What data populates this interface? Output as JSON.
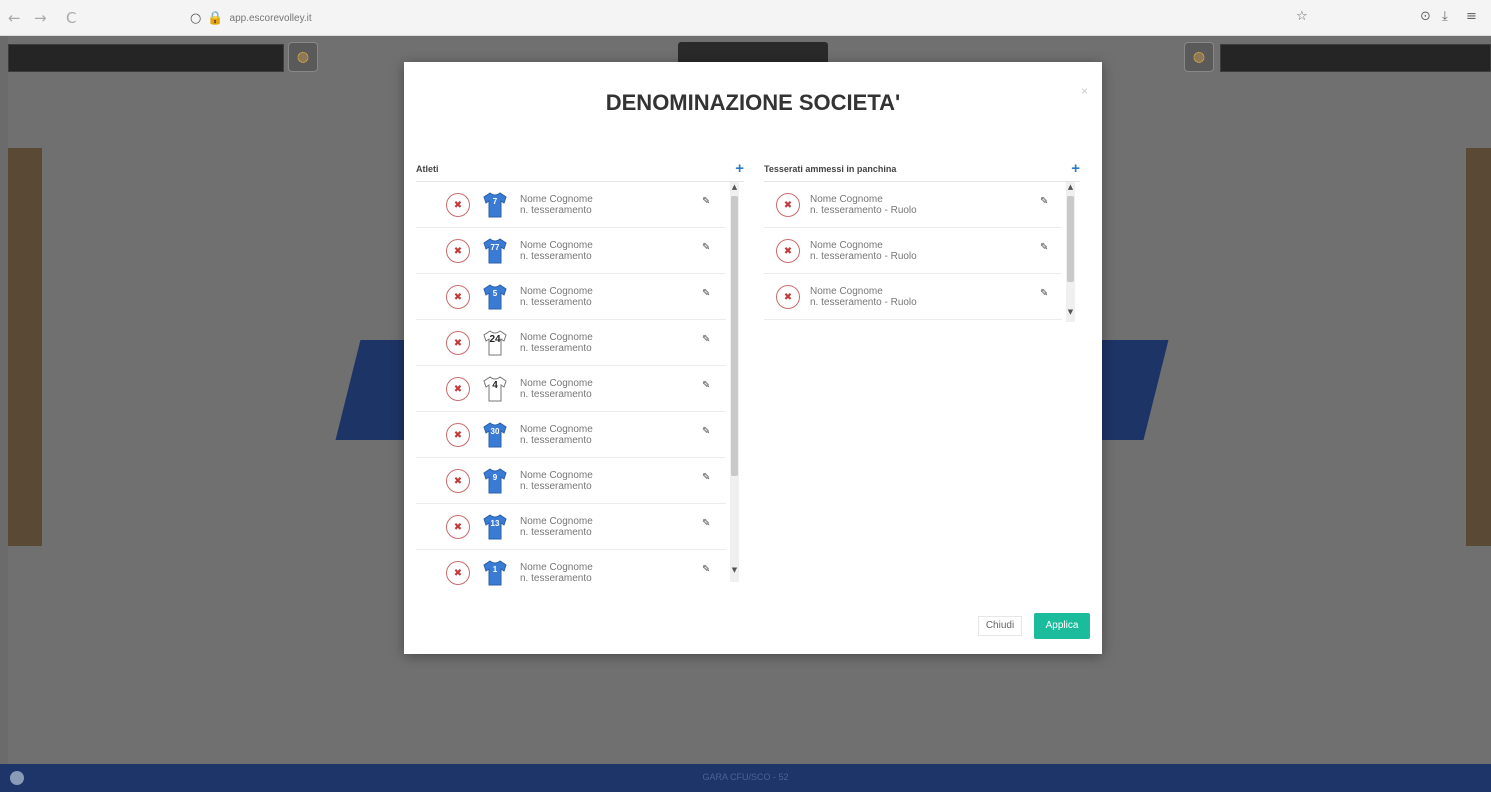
{
  "browser": {
    "back_icon": "←",
    "forward_icon": "→",
    "reload_icon": "C",
    "shield_icon": "○",
    "lock_icon": "🔒",
    "url": "app.escorevolley.it",
    "star_icon": "☆",
    "pocket_icon": "⊙",
    "download_icon": "⤓",
    "menu_icon": "≡"
  },
  "footer": {
    "text": "GARA CFU/SCO - 52"
  },
  "modal": {
    "title": "DENOMINAZIONE SOCIETA'",
    "close_icon": "×",
    "athletes": {
      "label": "Atleti",
      "add_icon": "+",
      "rows": [
        {
          "number": "7",
          "name": "Nome Cognome",
          "sub": "n. tesseramento",
          "jersey": "blue"
        },
        {
          "number": "77",
          "name": "Nome Cognome",
          "sub": "n. tesseramento",
          "jersey": "blue"
        },
        {
          "number": "5",
          "name": "Nome Cognome",
          "sub": "n. tesseramento",
          "jersey": "blue"
        },
        {
          "number": "24",
          "name": "Nome Cognome",
          "sub": "n. tesseramento",
          "jersey": "white"
        },
        {
          "number": "4",
          "name": "Nome Cognome",
          "sub": "n. tesseramento",
          "jersey": "white"
        },
        {
          "number": "30",
          "name": "Nome Cognome",
          "sub": "n. tesseramento",
          "jersey": "blue"
        },
        {
          "number": "9",
          "name": "Nome Cognome",
          "sub": "n. tesseramento",
          "jersey": "blue"
        },
        {
          "number": "13",
          "name": "Nome Cognome",
          "sub": "n. tesseramento",
          "jersey": "blue"
        },
        {
          "number": "1",
          "name": "Nome Cognome",
          "sub": "n. tesseramento",
          "jersey": "blue"
        }
      ]
    },
    "staff": {
      "label": "Tesserati ammessi in panchina",
      "add_icon": "+",
      "rows": [
        {
          "name": "Nome Cognome",
          "sub": "n. tesseramento - Ruolo"
        },
        {
          "name": "Nome Cognome",
          "sub": "n. tesseramento - Ruolo"
        },
        {
          "name": "Nome Cognome",
          "sub": "n. tesseramento - Ruolo"
        }
      ]
    },
    "remove_icon": "✖",
    "edit_icon": "✎",
    "close_label": "Chiudi",
    "apply_label": "Applica"
  },
  "colors": {
    "accent": "#1abc9c",
    "jersey_blue": "#3a7bd5",
    "remove": "#c23a3a"
  }
}
